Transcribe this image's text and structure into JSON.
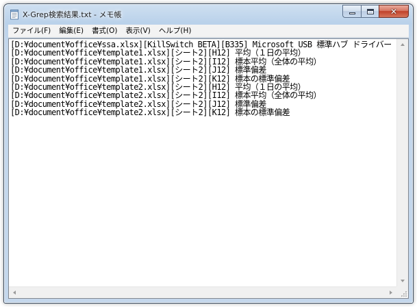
{
  "window": {
    "title": "X-Grep検索結果.txt - メモ帳",
    "icon": "notepad-icon"
  },
  "caption_buttons": {
    "minimize_icon": "minimize-icon",
    "maximize_icon": "maximize-icon",
    "close_label": "✕"
  },
  "menu": {
    "items": [
      {
        "label": "ファイル(F)"
      },
      {
        "label": "編集(E)"
      },
      {
        "label": "書式(O)"
      },
      {
        "label": "表示(V)"
      },
      {
        "label": "ヘルプ(H)"
      }
    ]
  },
  "document": {
    "lines": [
      "[D:¥document¥office¥ssa.xlsx][KillSwitch BETA][B335] Microsoft USB 標準ハブ ドライバー",
      "[D:¥document¥office¥template1.xlsx][シート2][H12] 平均（１日の平均）",
      "[D:¥document¥office¥template1.xlsx][シート2][I12] 標本平均（全体の平均）",
      "[D:¥document¥office¥template1.xlsx][シート2][J12] 標準偏差",
      "[D:¥document¥office¥template1.xlsx][シート2][K12] 標本の標準偏差",
      "[D:¥document¥office¥template2.xlsx][シート2][H12] 平均（１日の平均）",
      "[D:¥document¥office¥template2.xlsx][シート2][I12] 標本平均（全体の平均）",
      "[D:¥document¥office¥template2.xlsx][シート2][J12] 標準偏差",
      "[D:¥document¥office¥template2.xlsx][シート2][K12] 標本の標準偏差"
    ]
  },
  "colors": {
    "frame": "#b9d1ea",
    "close_button": "#c0412a",
    "menubar": "#f3f3f3",
    "text": "#000000"
  }
}
